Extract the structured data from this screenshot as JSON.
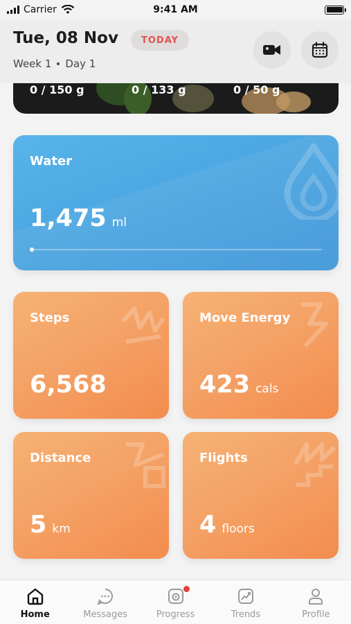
{
  "status_bar": {
    "carrier": "Carrier",
    "time": "9:41 AM"
  },
  "header": {
    "date": "Tue, 08 Nov",
    "today_badge": "TODAY",
    "week": "Week 1",
    "day": "Day 1",
    "video_icon": "video-camera-icon",
    "calendar_icon": "calendar-icon"
  },
  "food": {
    "values": [
      "0 / 150 g",
      "0 / 133 g",
      "0 / 50 g"
    ]
  },
  "water": {
    "title": "Water",
    "value": "1,475",
    "unit": "ml",
    "progress": 0.0,
    "icon": "water-drop-icon",
    "color": "#4aa3e0"
  },
  "stats": [
    {
      "key": "steps",
      "title": "Steps",
      "value": "6,568",
      "unit": "",
      "icon": "steps-icon"
    },
    {
      "key": "move_energy",
      "title": "Move Energy",
      "value": "423",
      "unit": "cals",
      "icon": "energy-icon"
    },
    {
      "key": "distance",
      "title": "Distance",
      "value": "5",
      "unit": "km",
      "icon": "distance-icon"
    },
    {
      "key": "flights",
      "title": "Flights",
      "value": "4",
      "unit": "floors",
      "icon": "flights-icon"
    }
  ],
  "accent_orange": "#f4a266",
  "tabs": [
    {
      "label": "Home",
      "icon": "home-icon",
      "active": true
    },
    {
      "label": "Messages",
      "icon": "chat-icon",
      "active": false
    },
    {
      "label": "Progress",
      "icon": "camera-progress-icon",
      "active": false,
      "badge": true
    },
    {
      "label": "Trends",
      "icon": "trend-chart-icon",
      "active": false
    },
    {
      "label": "Profile",
      "icon": "person-icon",
      "active": false
    }
  ]
}
